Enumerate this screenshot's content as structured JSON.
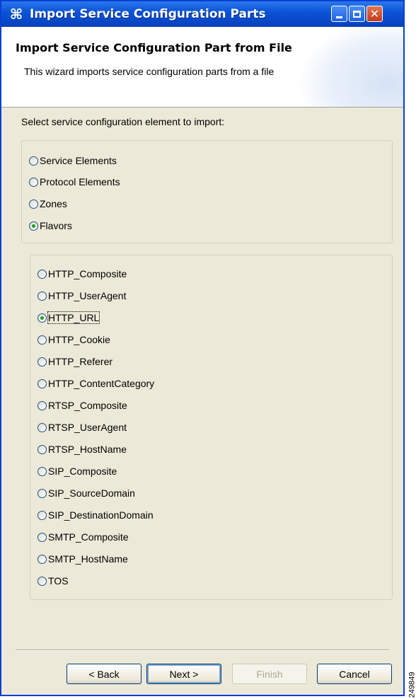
{
  "window": {
    "title": "Import Service Configuration Parts",
    "app_icon": "cisco-command-icon",
    "controls": {
      "minimize": "minimize-icon",
      "maximize": "maximize-icon",
      "close": "close-icon"
    }
  },
  "banner": {
    "title": "Import Service Configuration Part from File",
    "description": "This wizard imports service configuration parts from a file"
  },
  "prompt": "Select service configuration element to import:",
  "element_types": [
    {
      "label": "Service Elements",
      "checked": false
    },
    {
      "label": "Protocol Elements",
      "checked": false
    },
    {
      "label": "Zones",
      "checked": false
    },
    {
      "label": "Flavors",
      "checked": true
    }
  ],
  "flavors": [
    {
      "label": "HTTP_Composite",
      "checked": false
    },
    {
      "label": "HTTP_UserAgent",
      "checked": false
    },
    {
      "label": "HTTP_URL",
      "checked": true
    },
    {
      "label": "HTTP_Cookie",
      "checked": false
    },
    {
      "label": "HTTP_Referer",
      "checked": false
    },
    {
      "label": "HTTP_ContentCategory",
      "checked": false
    },
    {
      "label": "RTSP_Composite",
      "checked": false
    },
    {
      "label": "RTSP_UserAgent",
      "checked": false
    },
    {
      "label": "RTSP_HostName",
      "checked": false
    },
    {
      "label": "SIP_Composite",
      "checked": false
    },
    {
      "label": "SIP_SourceDomain",
      "checked": false
    },
    {
      "label": "SIP_DestinationDomain",
      "checked": false
    },
    {
      "label": "SMTP_Composite",
      "checked": false
    },
    {
      "label": "SMTP_HostName",
      "checked": false
    },
    {
      "label": "TOS",
      "checked": false
    }
  ],
  "buttons": {
    "back": "< Back",
    "next": "Next >",
    "finish": "Finish",
    "cancel": "Cancel"
  },
  "figure_id": "249849",
  "colors": {
    "titlebar": "#0b54d6",
    "dialog_bg": "#ece9d8",
    "radio_checked": "#21a121"
  }
}
